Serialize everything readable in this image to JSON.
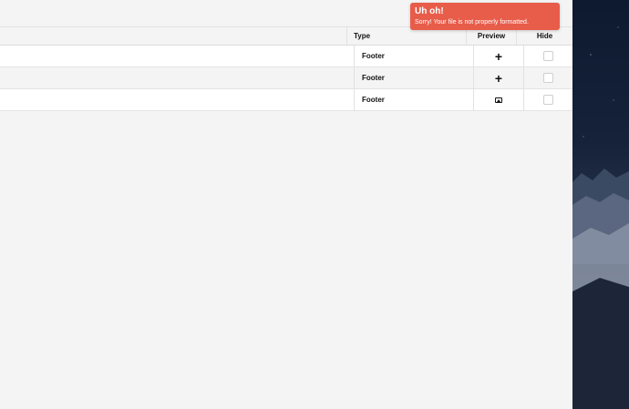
{
  "table": {
    "headers": {
      "type": "Type",
      "preview": "Preview",
      "hide": "Hide"
    },
    "rows": [
      {
        "type": "Footer",
        "preview_icon": "plus-icon",
        "hidden": false
      },
      {
        "type": "Footer",
        "preview_icon": "plus-icon",
        "hidden": false
      },
      {
        "type": "Footer",
        "preview_icon": "image-icon",
        "hidden": false
      }
    ]
  },
  "toast": {
    "title": "Uh oh!",
    "message": "Sorry! Your file is not properly formatted.",
    "color": "#e85c4a"
  },
  "colors": {
    "background": "#f4f4f4",
    "row_white": "#ffffff",
    "border": "#e2e2e2"
  }
}
